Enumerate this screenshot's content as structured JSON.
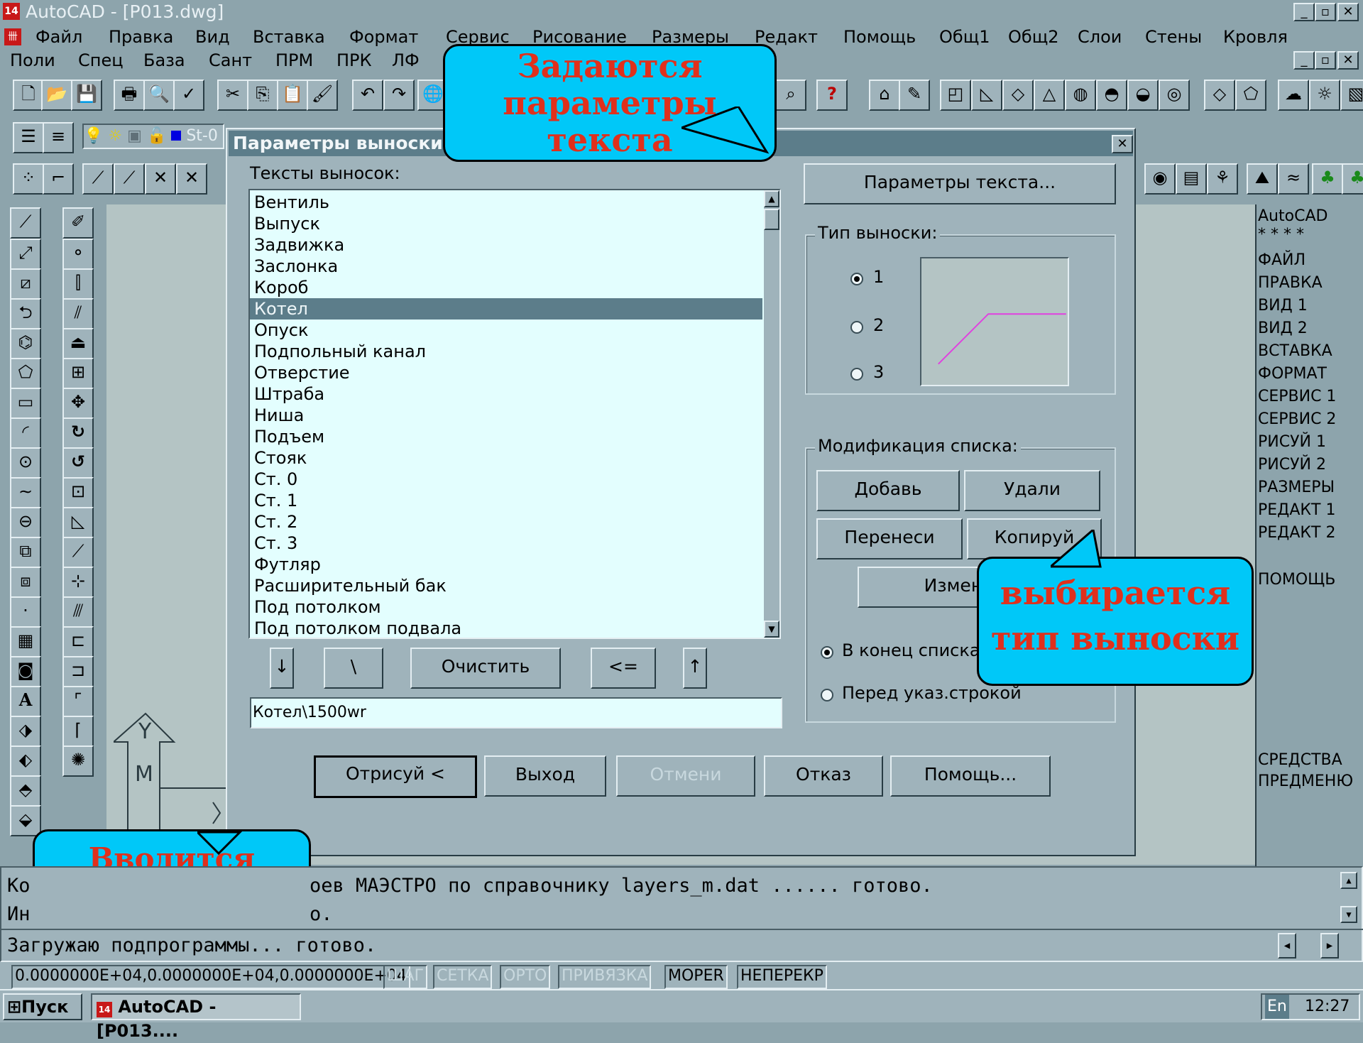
{
  "app": {
    "title": "AutoCAD - [P013.dwg]",
    "icon_text": "14"
  },
  "menu": {
    "row1": [
      "Файл",
      "Правка",
      "Вид",
      "Вставка",
      "Формат",
      "Сервис",
      "Рисование",
      "Размеры",
      "Редакт",
      "Помощь",
      "Общ1",
      "Общ2",
      "Слои",
      "Стены",
      "Кровля"
    ],
    "row2": [
      "Поли",
      "Спец",
      "База",
      "Сант",
      "ПРМ",
      "ПРК",
      "ЛФ"
    ]
  },
  "layer_combo": {
    "value": "St-0"
  },
  "dialog": {
    "title": "Параметры выноски",
    "list_label": "Тексты выносок:",
    "items": [
      "Вентиль",
      "Выпуск",
      "Задвижка",
      "Заслонка",
      "Короб",
      "Котел",
      "Опуск",
      "Подпольный канал",
      "Отверстие",
      "Штраба",
      "Ниша",
      "Подъем",
      "Стояк",
      "Ст. 0",
      "Ст. 1",
      "Ст. 2",
      "Ст. 3",
      "Футляр",
      "Расширительный бак",
      "Под потолком",
      "Под потолком подвала"
    ],
    "selected": "Котел",
    "text_params_button": "Параметры текста...",
    "leader_type": {
      "caption": "Тип выноски:",
      "options": [
        "1",
        "2",
        "3"
      ],
      "selected": "1"
    },
    "modify": {
      "caption": "Модификация списка:",
      "add": "Добавь",
      "delete": "Удали",
      "move": "Перенеси",
      "copy": "Копируй",
      "change": "Измени",
      "radio_end": "В конец списка",
      "radio_before": "Перед указ.строкой",
      "insert_mode": "В конец списка"
    },
    "under_list": {
      "down": "↓",
      "backslash": "\\",
      "clear": "Очистить",
      "back": "<=",
      "up": "↑"
    },
    "text_input": "Котел\\1500wr",
    "bottom": {
      "draw": "Отрисуй <",
      "exit": "Выход",
      "undo": "Отмени",
      "cancel": "Отказ",
      "help": "Помощь..."
    }
  },
  "callouts": {
    "top": "Задаются параметры текста",
    "right": "выбирается тип выноски",
    "bottom": "Вводится наименование"
  },
  "sidemenu": {
    "header": "AutoCAD",
    "stars": "* * * *",
    "items": [
      "ФАЙЛ",
      "ПРАВКА",
      "ВИД 1",
      "ВИД 2",
      "ВСТАВКА",
      "ФОРМАТ",
      "СЕРВИС 1",
      "СЕРВИС 2",
      "РИСУЙ 1",
      "РИСУЙ 2",
      "РАЗМЕРЫ",
      "РЕДАКТ 1",
      "РЕДАКТ 2"
    ],
    "help": "ПОМОЩЬ",
    "tools1": "СРЕДСТВА",
    "tools2": "ПРЕДМЕНЮ"
  },
  "command": {
    "line1_start": "Ко",
    "line1_end": "оев МАЭСТРО по справочнику layers_m.dat ...... готово.",
    "line2_start": "Ин",
    "line2_end": "о.",
    "line3": "Загружаю подпрограммы... готово."
  },
  "ucs": {
    "y": "Y",
    "m": "M"
  },
  "status": {
    "coords": "0.0000000E+04,0.0000000E+04,0.0000000E+04",
    "snap": "ШАГ",
    "grid": "СЕТКА",
    "ortho": "ОРТО",
    "osnap": "ПРИВЯЗКА",
    "model": "MOPER",
    "tilemode": "НЕПЕРЕКР"
  },
  "taskbar": {
    "start": "Пуск",
    "task": "AutoCAD - [P013....",
    "lang": "En",
    "time": "12:27"
  },
  "colors": {
    "accent": "#5c7d8a",
    "listbg": "#e3fefe",
    "callout_bg": "#00c8f8",
    "callout_text": "#e0301c",
    "leader_line": "#e040e0"
  }
}
